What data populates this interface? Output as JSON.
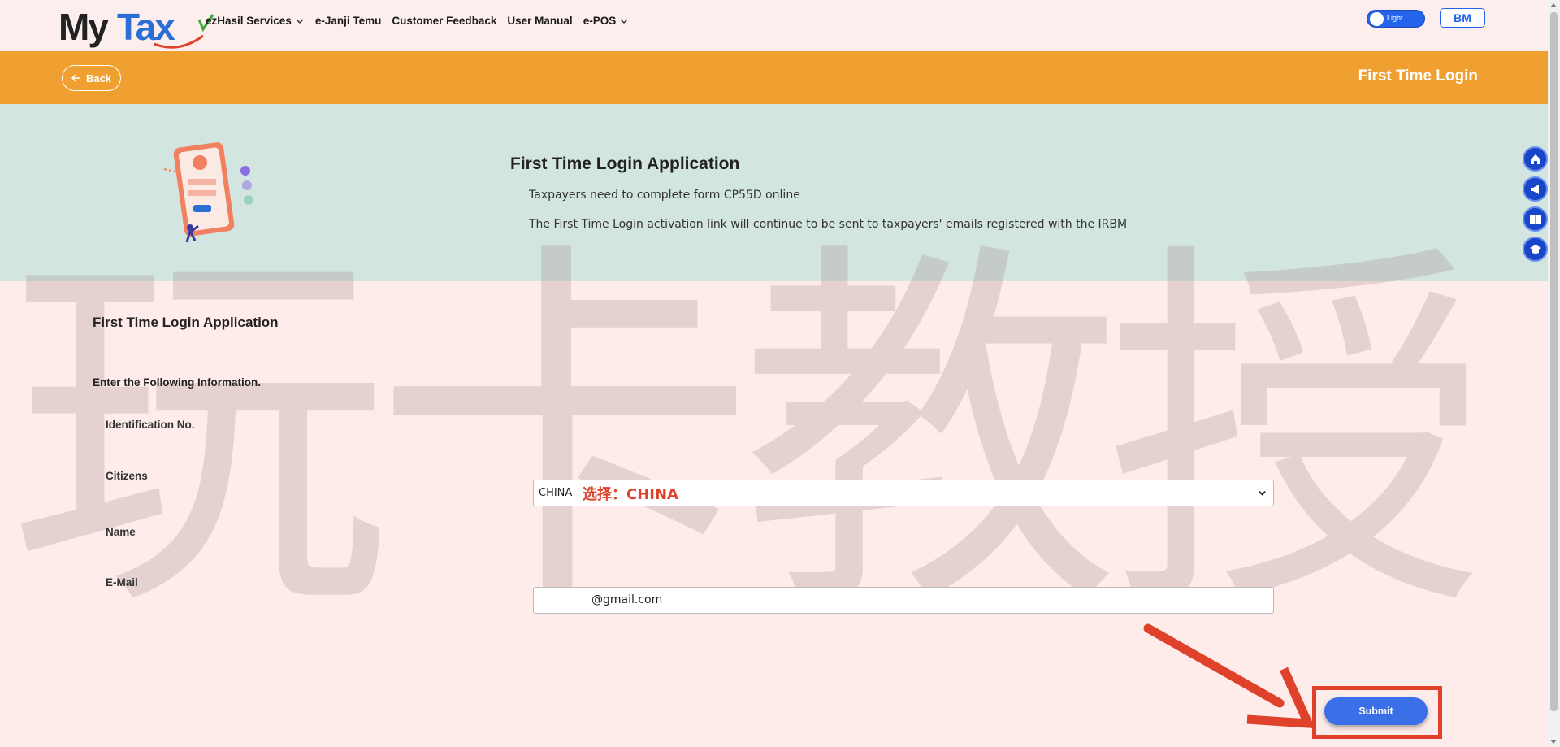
{
  "brand": {
    "logo_text_my": "My",
    "logo_text_tax": "Tax"
  },
  "nav": {
    "items": [
      {
        "label": "ezHasil Services",
        "has_dropdown": true
      },
      {
        "label": "e-Janji Temu",
        "has_dropdown": false
      },
      {
        "label": "Customer Feedback",
        "has_dropdown": false
      },
      {
        "label": "User Manual",
        "has_dropdown": false
      },
      {
        "label": "e-POS",
        "has_dropdown": true
      }
    ],
    "theme_toggle_label": "Light",
    "language_button": "BM"
  },
  "header": {
    "back_label": "Back",
    "page_title": "First Time Login"
  },
  "banner": {
    "title": "First Time Login Application",
    "line1": "Taxpayers need to complete form CP55D online",
    "line2": "The First Time Login activation link will continue to be sent to taxpayers' emails registered with the IRBM"
  },
  "side_icons": [
    "home-icon",
    "megaphone-icon",
    "book-icon",
    "graduation-cap-icon"
  ],
  "form": {
    "title": "First Time Login Application",
    "instruction": "Enter the Following Information.",
    "labels": {
      "identification": "Identification No.",
      "citizens": "Citizens",
      "name": "Name",
      "email": "E-Mail"
    },
    "citizens_value": "CHINA",
    "citizens_annotation": "选择：CHINA",
    "email_value": "@gmail.com",
    "submit_label": "Submit"
  },
  "watermark": "玩卡教授",
  "colors": {
    "orange_header": "#f0a030",
    "banner_bg": "#d3e5e1",
    "page_bg": "#fdecea",
    "accent_blue": "#3b6fe8",
    "annotation_red": "#e0412b"
  }
}
